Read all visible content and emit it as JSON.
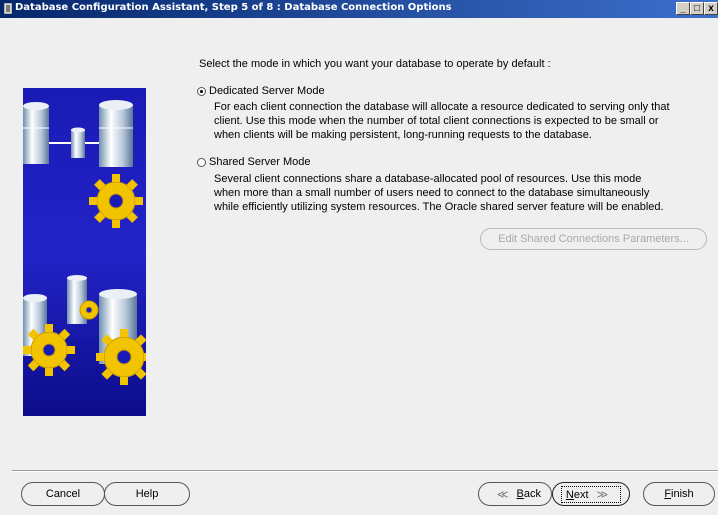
{
  "window": {
    "title": "Database Configuration Assistant, Step 5 of 8 : Database Connection Options",
    "min_glyph": "_",
    "max_glyph": "□",
    "close_glyph": "x"
  },
  "prompt": "Select the mode in which you want your database to operate by default :",
  "options": {
    "dedicated": {
      "label": "Dedicated Server Mode",
      "selected": true,
      "desc": [
        "For each client connection the database will allocate a resource dedicated to serving only that",
        "client.  Use this mode when the number of total client connections is expected to be small or",
        "when clients will be making persistent, long-running requests to the database."
      ]
    },
    "shared": {
      "label": "Shared Server Mode",
      "selected": false,
      "desc": [
        "Several client connections share a database-allocated pool of resources.  Use this mode",
        "when more than a small number of users need to connect to the database simultaneously",
        "while efficiently utilizing system resources.  The Oracle shared server feature will be enabled."
      ]
    }
  },
  "buttons": {
    "edit": "Edit Shared Connections Parameters...",
    "edit_enabled": false,
    "cancel": "Cancel",
    "help": "Help",
    "back_mnemonic": "B",
    "back_rest": "ack",
    "next_mnemonic": "N",
    "next_rest": "ext",
    "finish_mnemonic": "F",
    "finish_rest": "inish",
    "arrow_left": "≪",
    "arrow_right": "≫"
  },
  "colors": {
    "titlebar": "#0a2d74",
    "banner": "#1515a8",
    "gear": "#f2c400",
    "window_bg": "#efefef"
  }
}
